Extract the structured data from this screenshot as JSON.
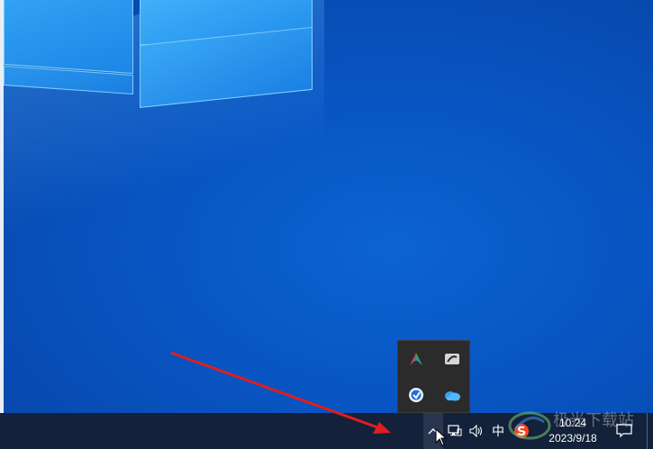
{
  "taskbar": {
    "ime_label": "中",
    "time": "10:24",
    "date": "2023/9/18"
  },
  "tray_flyout": {
    "icons": [
      "defender-icon",
      "cloud-sync-icon",
      "browser-icon",
      "onedrive-icon"
    ]
  },
  "icons": {
    "chevron": "chevron-up-icon",
    "network": "network-icon",
    "volume": "volume-icon",
    "input_method": "sogou-input-icon",
    "notification": "action-center-icon"
  },
  "colors": {
    "taskbar": "#13213a",
    "desktop": "#0a58c9",
    "annotation_arrow": "#e11d1d"
  },
  "watermark": {
    "text": "极光下载站"
  }
}
